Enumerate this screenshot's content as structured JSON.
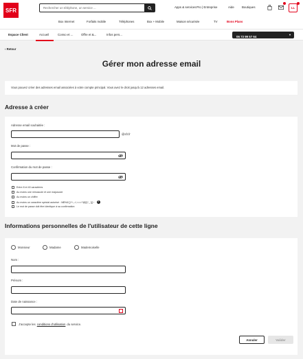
{
  "header": {
    "logo": "SFR",
    "search_placeholder": "Rechercher un téléphone, un service ...",
    "top_links": [
      "Apps & services",
      "Pro | Entreprise",
      "Aide",
      "Boutiques"
    ],
    "account_initials": "LL",
    "main_nav": [
      "Box Internet",
      "Forfaits mobile",
      "Téléphones",
      "Box + Mobile",
      "Maison sécurisée",
      "TV",
      "Bons Plans"
    ]
  },
  "subnav": {
    "brand": "Espace Client",
    "items": [
      "Accueil",
      "Conso et ...",
      "Offre et &...",
      "Infos pers..."
    ],
    "phone": "06 73 99 57 64"
  },
  "back_label": "Retour",
  "page_title": "Gérer mon adresse email",
  "info_text": "Vous pouvez créer des adresses email associées à votre compte principal. Vous avez le droit jusqu'à 12 adresses email.",
  "create_section": {
    "title": "Adresse à créer",
    "email_label": "Adresse email souhaitée :",
    "email_value": "",
    "email_suffix": "@sfr.fr",
    "password_label": "Mot de passe :",
    "password_value": "",
    "confirm_label": "Confirmation du mot de passe :",
    "confirm_value": "",
    "rules": [
      "Entre 8 et 40 caractères",
      "Au moins une minuscule et une majuscule",
      "Au moins un chiffre",
      "Au moins un caractère spécial autorisé : !#$%&'()*+,-./:;<=>?@[\\]^_`{|}~",
      "Le mot de passe doit être identique à sa confirmation"
    ]
  },
  "personal_section": {
    "title": "Informations personnelles de l'utilisateur de cette ligne",
    "civility": [
      "Monsieur",
      "Madame",
      "Mademoiselle"
    ],
    "lastname_label": "Nom :",
    "lastname_value": "",
    "firstname_label": "Prénom :",
    "firstname_value": "",
    "birthdate_label": "Date de naissance :",
    "birthdate_value": "",
    "accept_prefix": "J'accepte les",
    "accept_link": "conditions d'utilisation",
    "accept_suffix": "du service.",
    "cancel_label": "Annuler",
    "validate_label": "Valider"
  },
  "colors": {
    "brand_red": "#e2001a",
    "dark": "#222222",
    "background": "#f2f2f2"
  }
}
